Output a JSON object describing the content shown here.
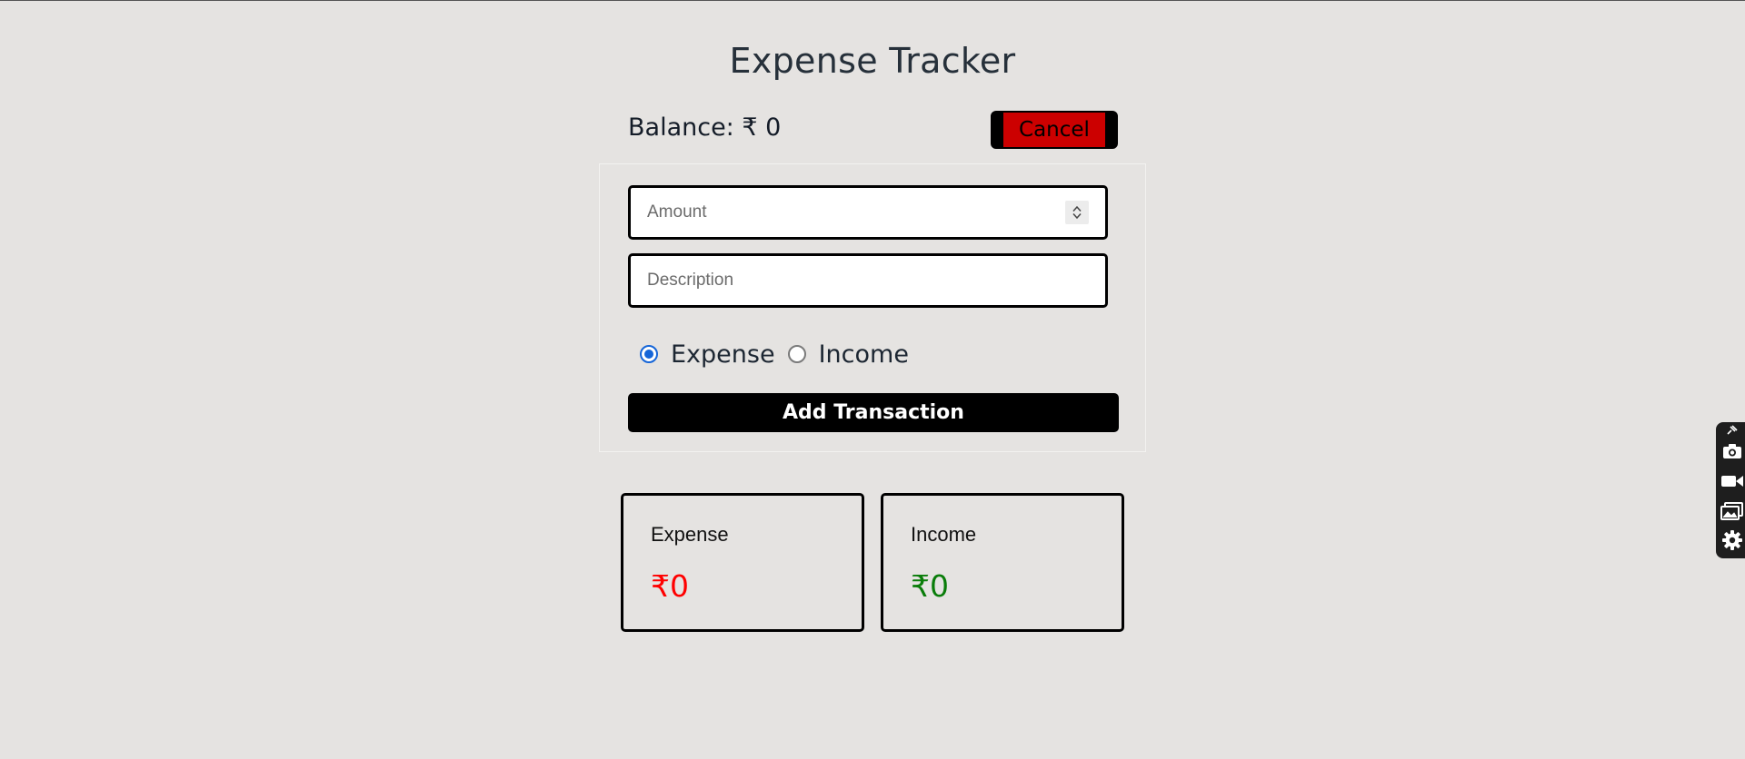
{
  "app": {
    "title": "Expense Tracker",
    "balance_label": "Balance: ₹ 0"
  },
  "header": {
    "cancel_label": "Cancel"
  },
  "form": {
    "amount_placeholder": "Amount",
    "amount_value": "",
    "description_placeholder": "Description",
    "description_value": "",
    "type_options": [
      {
        "label": "Expense",
        "checked": true
      },
      {
        "label": "Income",
        "checked": false
      }
    ],
    "submit_label": "Add Transaction"
  },
  "summary": {
    "expense": {
      "label": "Expense",
      "value": "₹0",
      "color": "#ff0000"
    },
    "income": {
      "label": "Income",
      "value": "₹0",
      "color": "#0a7d0a"
    }
  },
  "colors": {
    "background": "#e5e3e1",
    "cancel_bg": "#cc0000",
    "radio_accent": "#1565d8"
  },
  "side_toolbar": {
    "icons": [
      "pin-icon",
      "camera-icon",
      "video-icon",
      "gallery-icon",
      "gear-icon"
    ]
  }
}
